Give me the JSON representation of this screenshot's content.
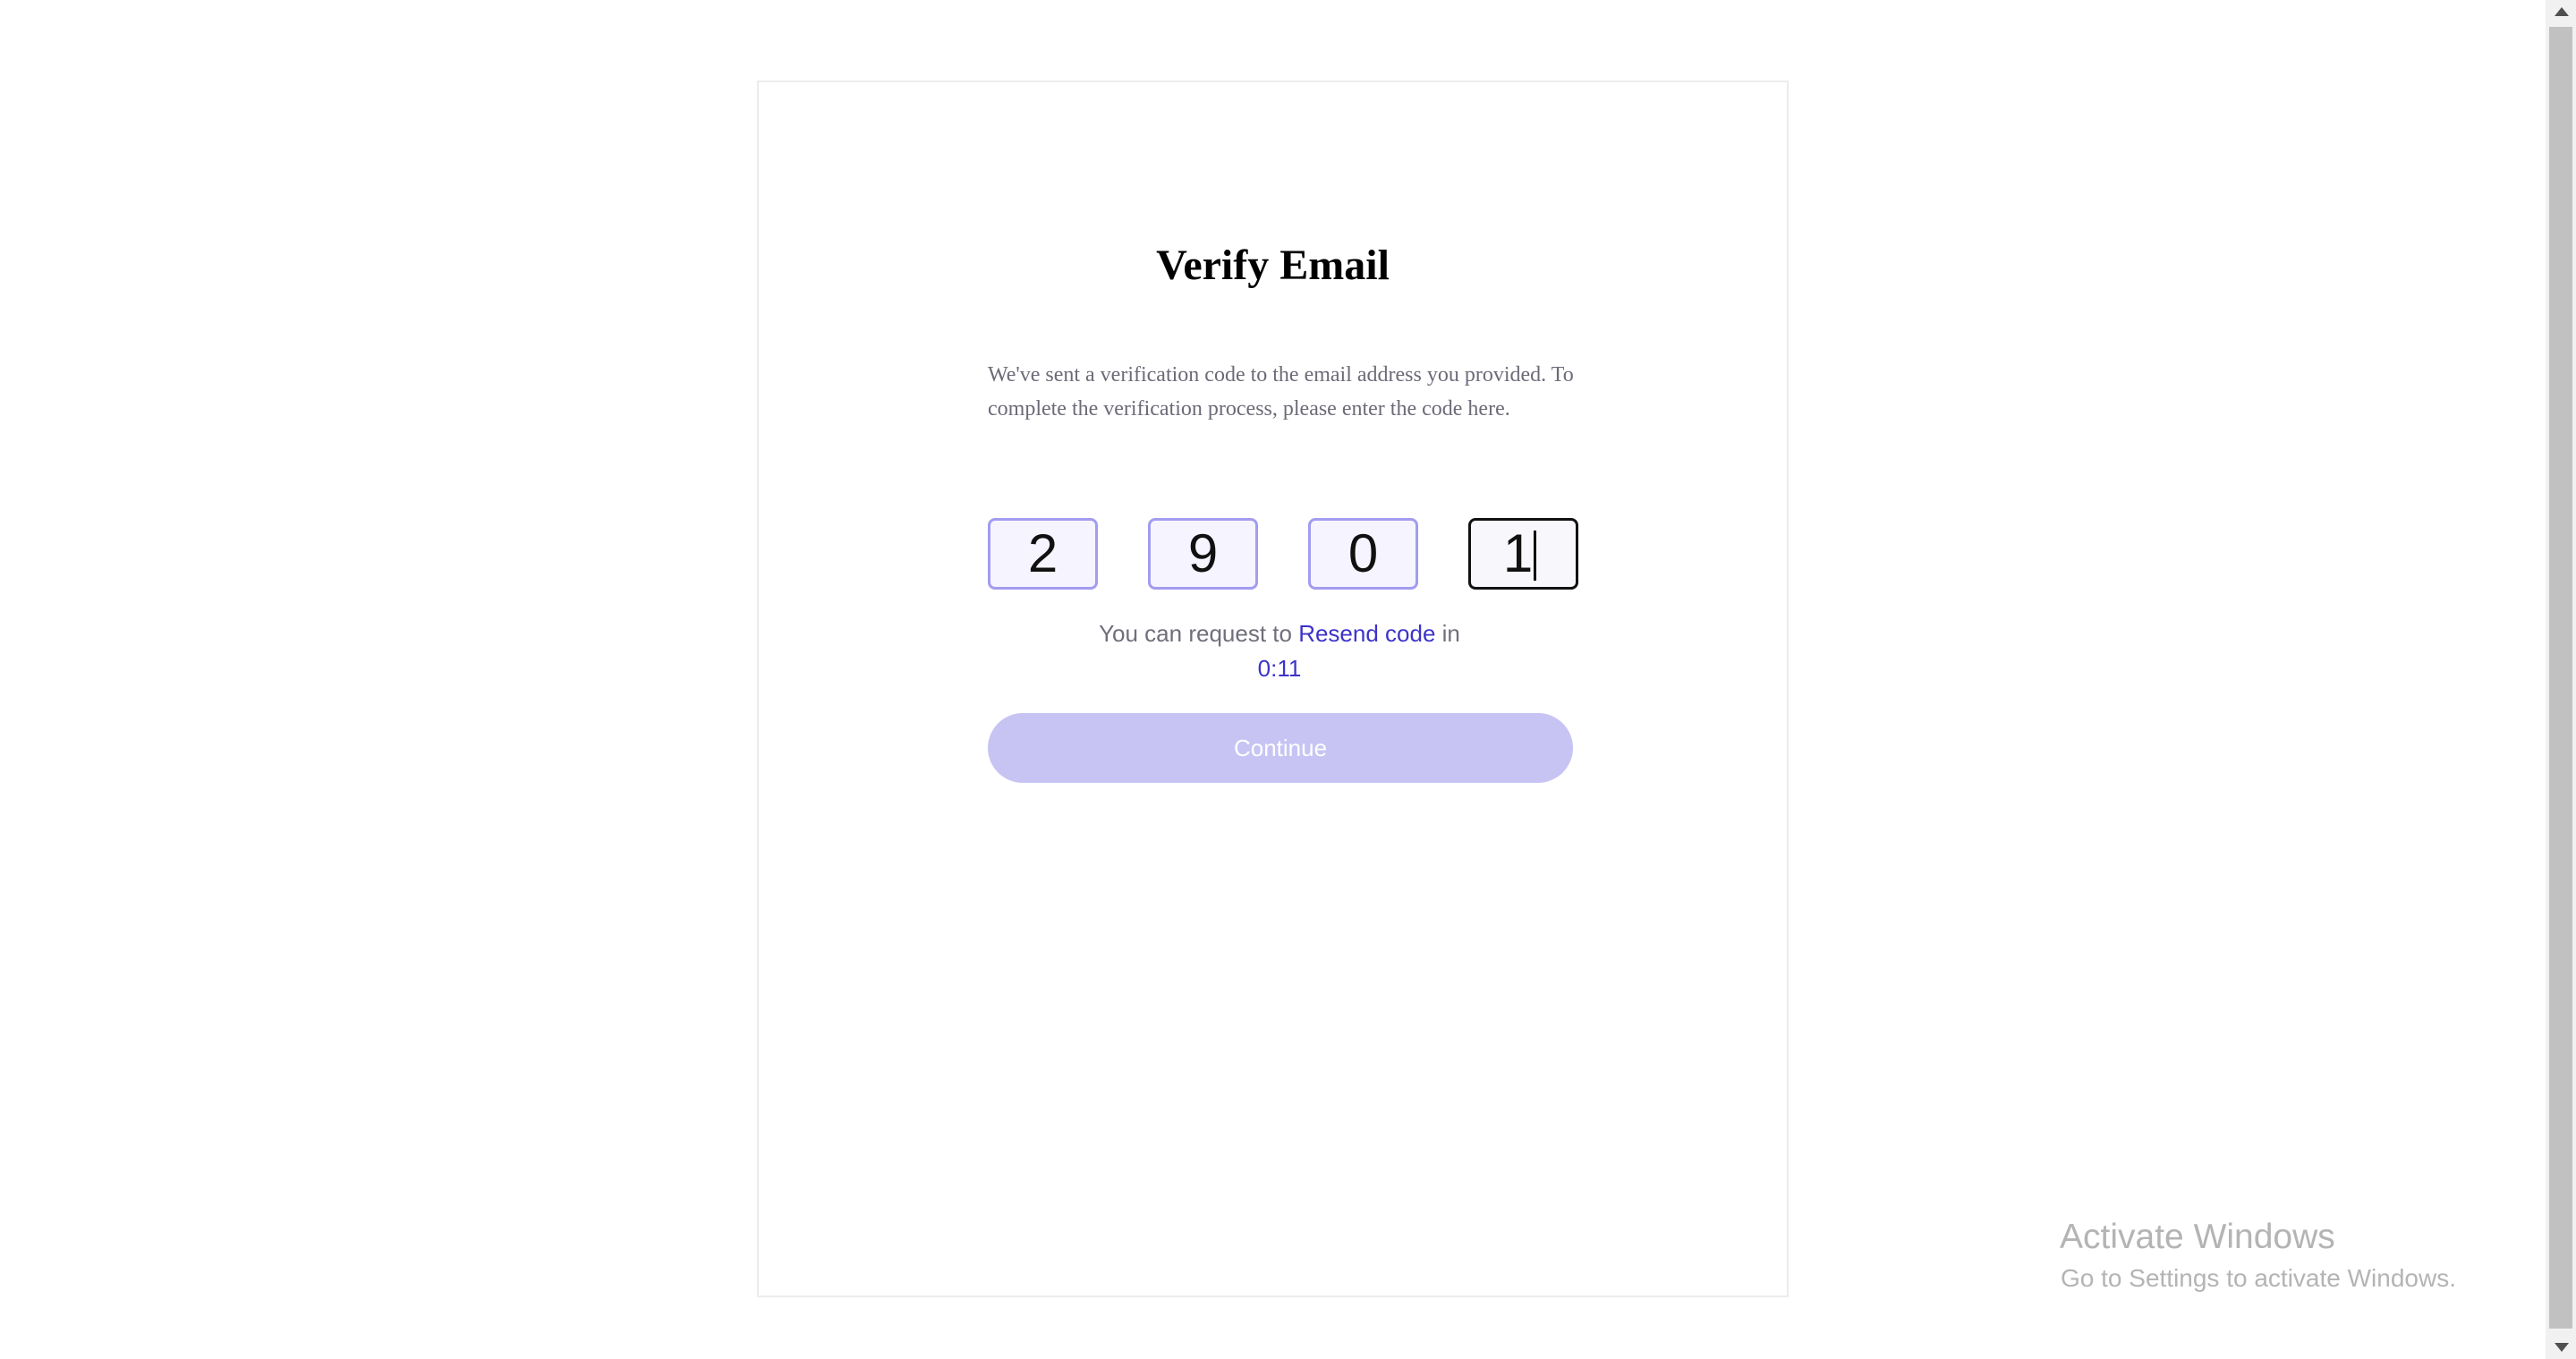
{
  "card": {
    "title": "Verify Email",
    "description": "We've sent a verification code to the email address you provided. To complete the verification process, please enter the code here."
  },
  "otp": {
    "digits": [
      "2",
      "9",
      "0",
      "1"
    ],
    "active_index": 3
  },
  "resend": {
    "prefix": "You can request to",
    "link_label": "Resend code",
    "suffix": "in",
    "timer": "0:11"
  },
  "actions": {
    "continue_label": "Continue"
  },
  "watermark": {
    "title": "Activate Windows",
    "subtitle": "Go to Settings to activate Windows."
  },
  "colors": {
    "accent": "#3d33c9",
    "button_disabled": "#c7c4f4",
    "input_border": "#a39cf0",
    "input_bg": "#f6f5ff"
  },
  "icons": {
    "scroll_up": "triangle-up-icon",
    "scroll_down": "triangle-down-icon"
  }
}
